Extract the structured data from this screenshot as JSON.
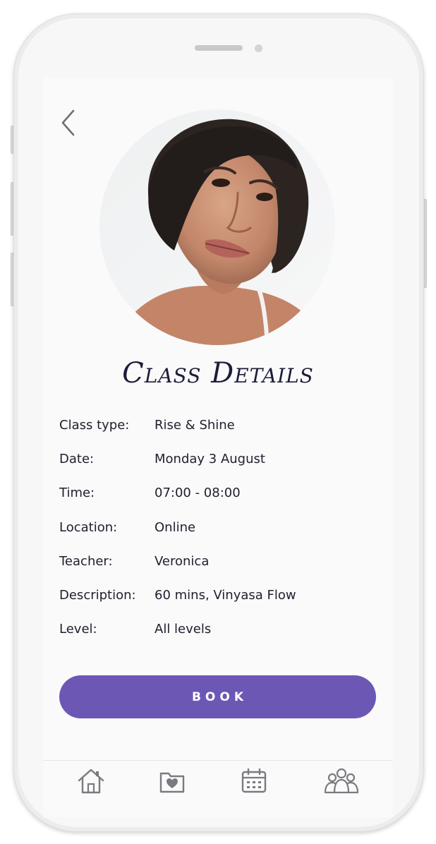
{
  "page": {
    "title": "Class Details"
  },
  "icons": {
    "back": "chevron-left-icon",
    "tabs": [
      "home-icon",
      "folder-heart-icon",
      "calendar-icon",
      "community-icon"
    ]
  },
  "details": [
    {
      "label": "Class type:",
      "value": "Rise & Shine"
    },
    {
      "label": "Date:",
      "value": "Monday 3 August"
    },
    {
      "label": "Time:",
      "value": "07:00 - 08:00"
    },
    {
      "label": "Location:",
      "value": "Online"
    },
    {
      "label": "Teacher:",
      "value": "Veronica"
    },
    {
      "label": "Description:",
      "value": "60 mins, Vinyasa Flow"
    },
    {
      "label": "Level:",
      "value": "All levels"
    }
  ],
  "actions": {
    "book_label": "BOOK"
  },
  "colors": {
    "accent": "#6d57b5",
    "title": "#1d1d3a",
    "text": "#1f1f2e",
    "icon": "#7a7a80"
  }
}
